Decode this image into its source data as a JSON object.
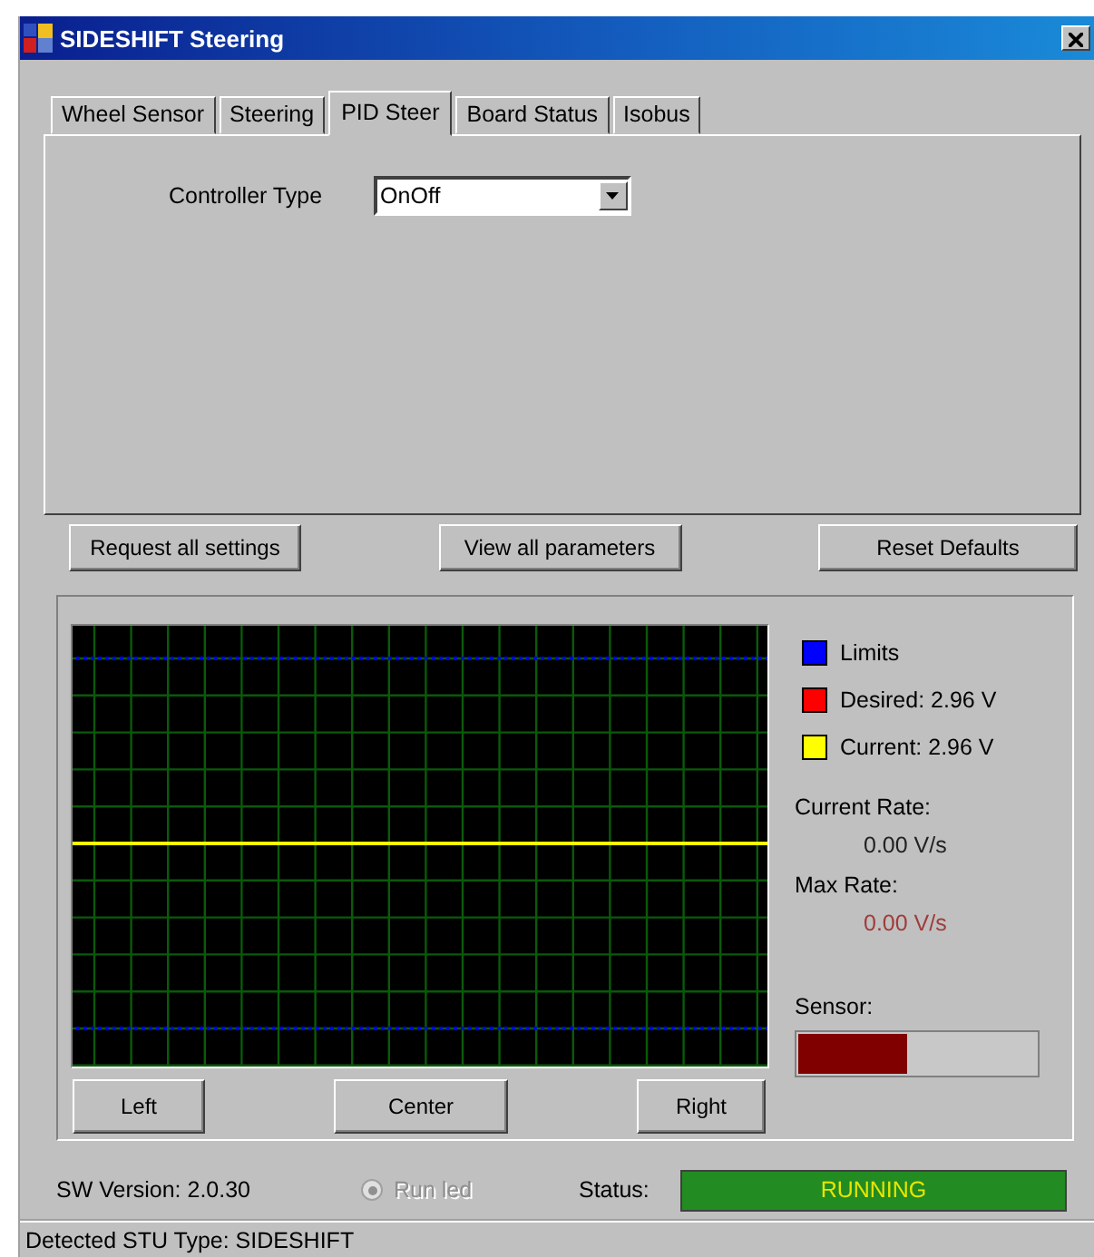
{
  "window": {
    "title": "SIDESHIFT Steering"
  },
  "tabs": [
    {
      "label": "Wheel Sensor",
      "selected": false
    },
    {
      "label": "Steering",
      "selected": false
    },
    {
      "label": "PID Steer",
      "selected": true
    },
    {
      "label": "Board Status",
      "selected": false
    },
    {
      "label": "Isobus",
      "selected": false
    }
  ],
  "controller_type": {
    "label": "Controller Type",
    "value": "OnOff"
  },
  "action_buttons": [
    "Request all settings",
    "View all parameters",
    "Reset Defaults"
  ],
  "legend": [
    {
      "label": "Limits",
      "color": "#0000ff"
    },
    {
      "label": "Desired: 2.96 V",
      "color": "#ff0000"
    },
    {
      "label": "Current: 2.96 V",
      "color": "#ffff00"
    }
  ],
  "rates": [
    {
      "label": "Current Rate:",
      "value": "0.00 V/s",
      "color": "#222222"
    },
    {
      "label": "Max Rate:",
      "value": "0.00 V/s",
      "color": "#a03c3c"
    }
  ],
  "sensor": {
    "label": "Sensor:",
    "level": 0.46
  },
  "position_buttons": [
    "Left",
    "Center",
    "Right"
  ],
  "sw_version": "SW Version: 2.0.30",
  "run_led": {
    "label": "Run led",
    "disabled": true,
    "checked": true
  },
  "status": {
    "label": "Status:",
    "value": "RUNNING"
  },
  "status_bar": "Detected STU Type: SIDESHIFT"
}
